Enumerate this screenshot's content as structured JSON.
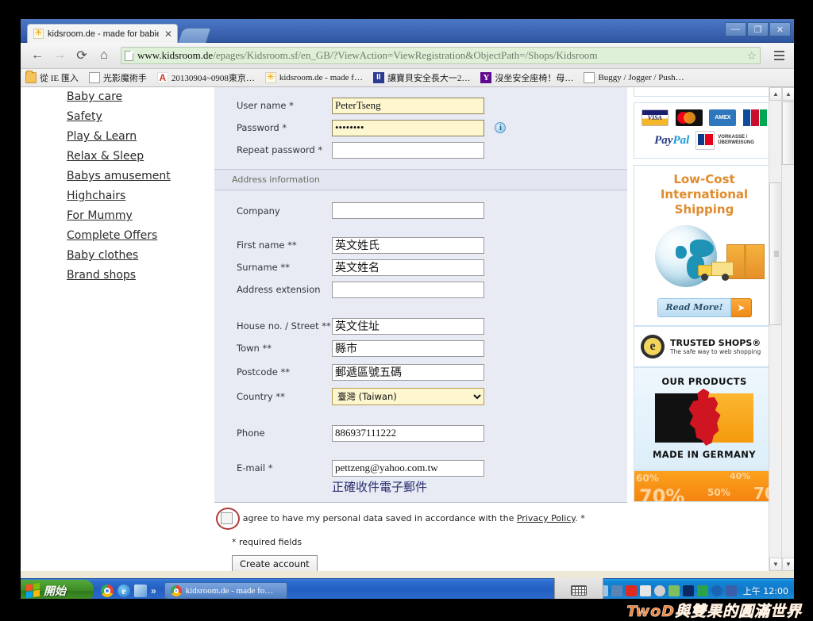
{
  "browser": {
    "tab": {
      "title": "kidsroom.de - made for babie",
      "close_label": "✕",
      "favicon": "star-icon"
    },
    "window_controls": {
      "minimize": "—",
      "maximize": "❐",
      "close": "✕"
    },
    "nav": {
      "back": "←",
      "forward": "→",
      "reload": "⟳",
      "home": "⌂",
      "menu": "menu-icon"
    },
    "url_main": "www.kidsroom.de",
    "url_rest": "/epages/Kidsroom.sf/en_GB/?ViewAction=ViewRegistration&ObjectPath=/Shops/Kidsroom",
    "bookmark_star": "☆",
    "bookmarks": [
      {
        "label": "從 IE 匯入",
        "icon": "folder-icon"
      },
      {
        "label": "光影魔術手",
        "icon": "page-icon"
      },
      {
        "label": "20130904~0908東京…",
        "icon": "pdf-icon"
      },
      {
        "label": "kidsroom.de - made f…",
        "icon": "star-icon"
      },
      {
        "label": "讓寶貝安全長大一2…",
        "icon": "blue-square-icon"
      },
      {
        "label": "沒坐安全座椅！母…",
        "icon": "yahoo-icon"
      },
      {
        "label": "Buggy / Jogger / Push…",
        "icon": "page-icon"
      }
    ]
  },
  "sidebar": {
    "items": [
      {
        "label": "Baby care"
      },
      {
        "label": "Safety"
      },
      {
        "label": "Play & Learn"
      },
      {
        "label": "Relax & Sleep"
      },
      {
        "label": "Babys amusement"
      },
      {
        "label": "Highchairs"
      },
      {
        "label": "For Mummy"
      },
      {
        "label": "Complete Offers"
      },
      {
        "label": "Baby clothes"
      },
      {
        "label": "Brand shops"
      }
    ]
  },
  "form": {
    "login_section": {
      "fields": [
        {
          "label": "User name *",
          "value": "PeterTseng",
          "autofill": true,
          "type": "text"
        },
        {
          "label": "Password *",
          "value": "••••••••",
          "autofill": true,
          "type": "password",
          "info_icon": "i"
        },
        {
          "label": "Repeat password *",
          "value": "",
          "autofill": false,
          "type": "password"
        }
      ]
    },
    "address_section": {
      "header": "Address information",
      "company": {
        "label": "Company",
        "value": ""
      },
      "first_name": {
        "label": "First name **",
        "value": "英文姓氏"
      },
      "surname": {
        "label": "Surname **",
        "value": "英文姓名"
      },
      "address_extension": {
        "label": "Address extension",
        "value": ""
      },
      "house_street": {
        "label": "House no. / Street **",
        "value": "英文住址"
      },
      "town": {
        "label": "Town **",
        "value": "縣市"
      },
      "postcode": {
        "label": "Postcode **",
        "value": "郵遞區號五碼"
      },
      "country": {
        "label": "Country **",
        "value": "臺灣 (Taiwan)",
        "options": [
          "臺灣 (Taiwan)"
        ]
      },
      "phone": {
        "label": "Phone",
        "value": "886937111222"
      },
      "email": {
        "label": "E-mail *",
        "value": "pettzeng@yahoo.com.tw",
        "hint": "正確收件電子郵件"
      }
    },
    "consent": {
      "checked": false,
      "text_before": "I agree to have my personal data saved in accordance with the ",
      "link": "Privacy Policy",
      "text_after": ". *"
    },
    "required_note": "* required fields",
    "submit_label": "Create account"
  },
  "right_panel": {
    "payment": {
      "cards": [
        "VISA",
        "MasterCard",
        "AMEX",
        "JCB"
      ],
      "paypal": "PayPal",
      "paypal_mark": "™",
      "bank": {
        "line1": "VORKASSE /",
        "line2": "ÜBERWEISUNG"
      }
    },
    "shipping_ad": {
      "line1": "Low-Cost",
      "line2": "International",
      "line3": "Shipping",
      "cta": "Read More!",
      "cta_arrow": "➤"
    },
    "trusted_shops": {
      "title": "TRUSTED SHOPS®",
      "subtitle": "The safe way to web shopping"
    },
    "made_in_germany": {
      "top": "OUR PRODUCTS",
      "bottom": "MADE IN GERMANY"
    },
    "promo": {
      "a": "60%",
      "b": "70%",
      "c": "50%",
      "d": "70",
      "e": "40%"
    }
  },
  "taskbar": {
    "start_label": "開始",
    "quicklaunch": [
      "chrome-icon",
      "ie-icon",
      "app-icon"
    ],
    "more": "»",
    "task": {
      "label": "kidsroom.de - made fo…",
      "icon": "chrome-icon"
    },
    "tray_time": "上午 12:00"
  },
  "watermark": {
    "text": "TwoD與雙果的圓滿世界"
  }
}
